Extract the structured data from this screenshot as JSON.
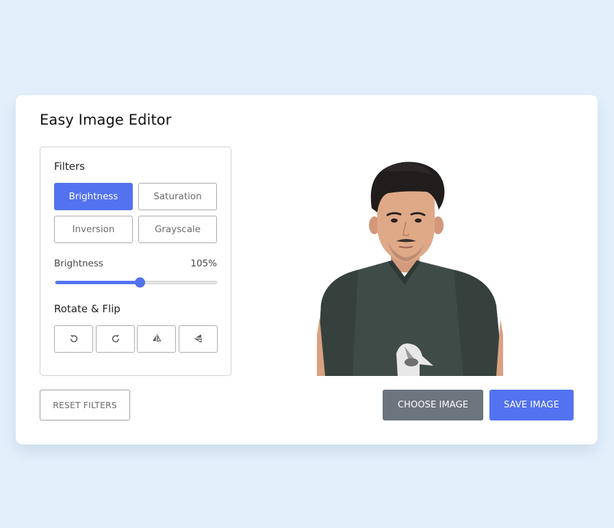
{
  "title": "Easy Image Editor",
  "filters": {
    "title": "Filters",
    "buttons": [
      {
        "label": "Brightness",
        "active": true
      },
      {
        "label": "Saturation",
        "active": false
      },
      {
        "label": "Inversion",
        "active": false
      },
      {
        "label": "Grayscale",
        "active": false
      }
    ]
  },
  "slider": {
    "label": "Brightness",
    "value_text": "105%",
    "value": 105,
    "max": 200
  },
  "rotate": {
    "title": "Rotate & Flip",
    "icons": [
      "rotate-left-icon",
      "rotate-right-icon",
      "flip-horizontal-icon",
      "flip-vertical-icon"
    ]
  },
  "actions": {
    "reset": "RESET FILTERS",
    "choose": "CHOOSE IMAGE",
    "save": "SAVE IMAGE"
  },
  "colors": {
    "background": "#e3f0fc",
    "accent": "#5372f0",
    "secondary": "#6c757d"
  }
}
